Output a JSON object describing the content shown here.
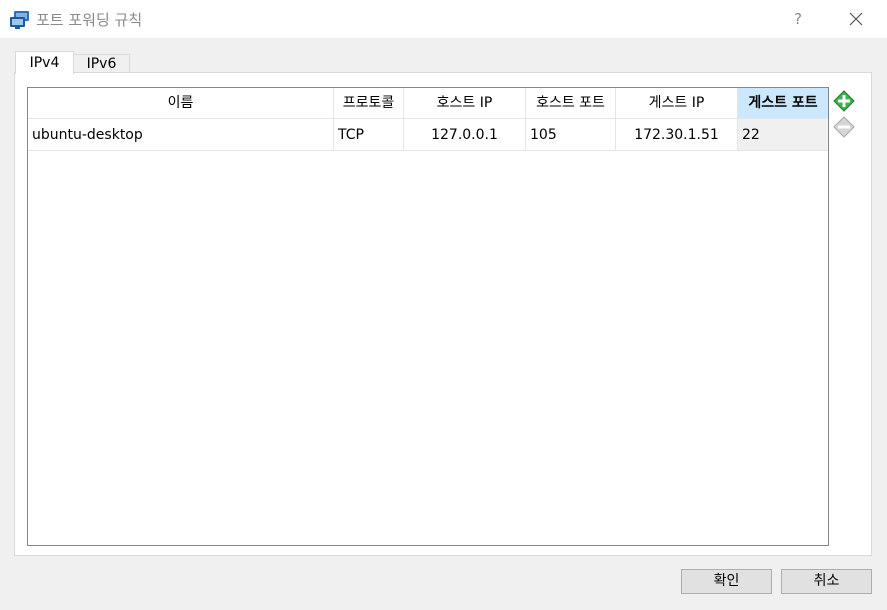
{
  "window": {
    "title": "포트 포워딩 규칙",
    "help_label": "?",
    "close_glyph": "✕",
    "icon": "virtualbox-network-icon"
  },
  "tabs": [
    {
      "label": "IPv4",
      "active": true
    },
    {
      "label": "IPv6",
      "active": false
    }
  ],
  "table": {
    "columns": [
      "이름",
      "프로토콜",
      "호스트 IP",
      "호스트 포트",
      "게스트 IP",
      "게스트 포트"
    ],
    "selected_column": "게스트 포트",
    "rows": [
      [
        "ubuntu-desktop",
        "TCP",
        "127.0.0.1",
        "105",
        "172.30.1.51",
        "22"
      ]
    ]
  },
  "side_buttons": [
    {
      "icon": "add-rule-icon",
      "enabled": true
    },
    {
      "icon": "remove-rule-icon",
      "enabled": false
    }
  ],
  "footer": {
    "ok_label": "확인",
    "cancel_label": "취소"
  },
  "colors": {
    "header_selected": "#cce8ff",
    "add_icon_green": "#3cb44a",
    "disabled_gray": "#bdbdbd"
  }
}
